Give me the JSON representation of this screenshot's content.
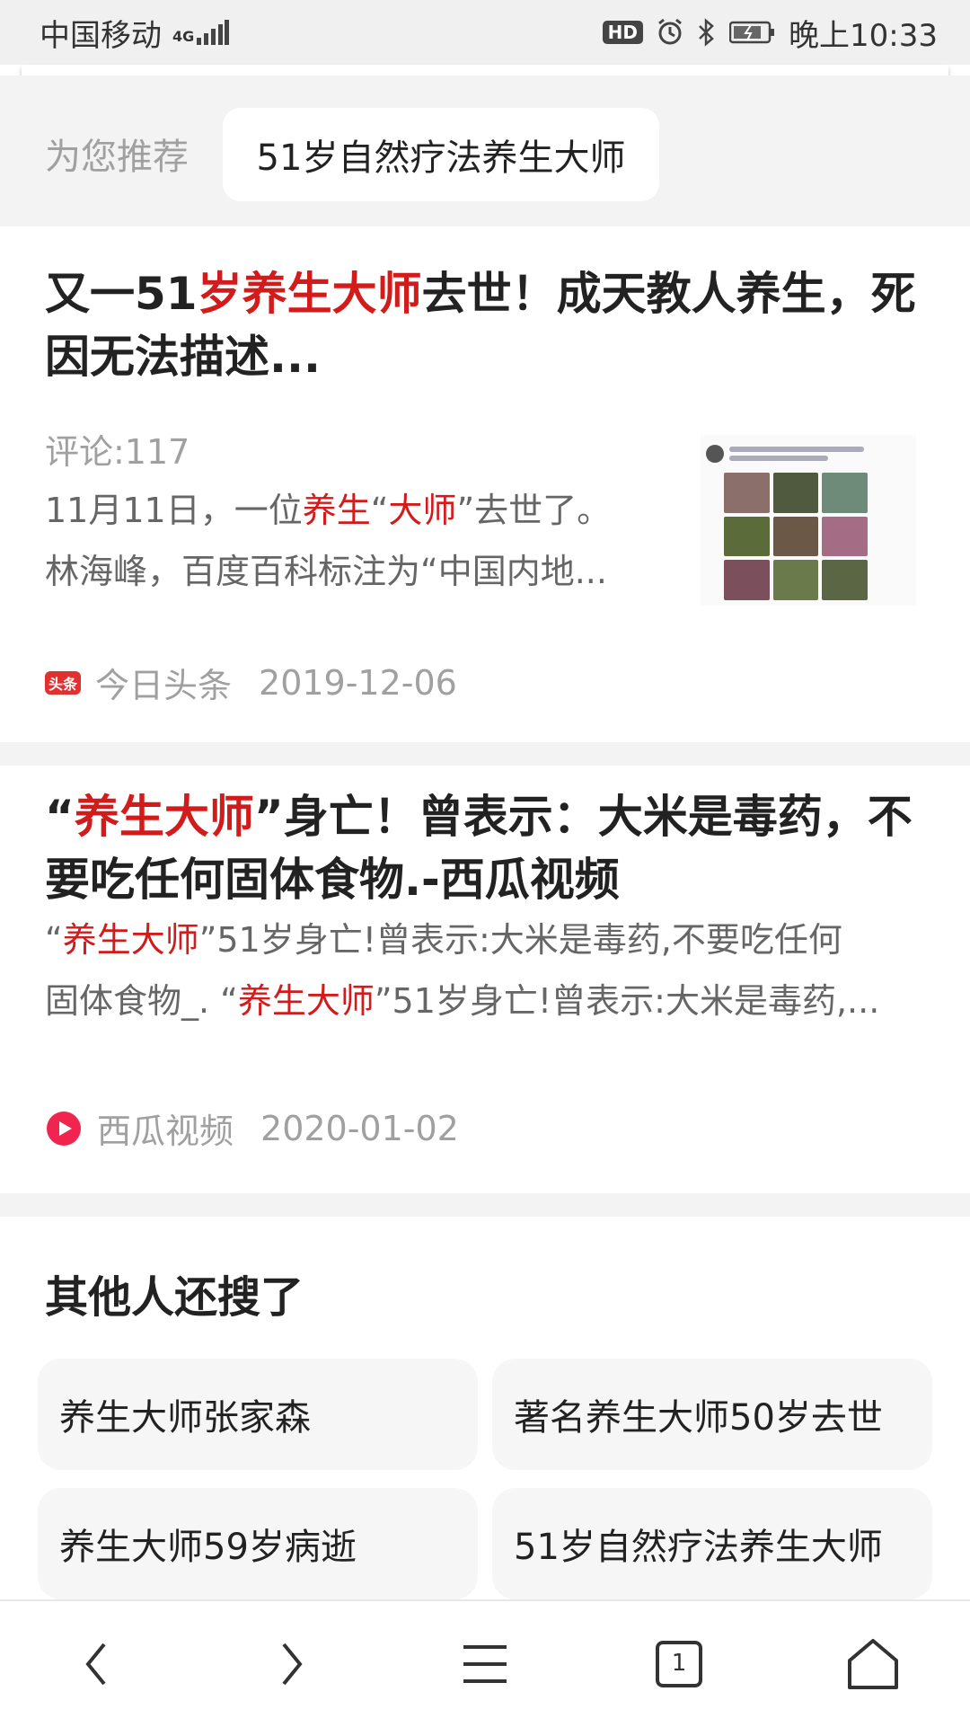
{
  "status_bar": {
    "carrier": "中国移动",
    "network": "4G",
    "hd_badge": "HD",
    "time": "晚上10:33"
  },
  "recommend": {
    "label": "为您推荐",
    "chip": "51岁自然疗法养生大师"
  },
  "results": [
    {
      "title_parts": [
        "又一51",
        "岁养生大师",
        "去世！成天教人养生，死因无法描述..."
      ],
      "comments": "评论:117",
      "snippet_line1_parts": [
        "11月11日，一位",
        "养生",
        "“",
        "大师",
        "”去世了。"
      ],
      "snippet_line2": "林海峰，百度百科标注为“中国内地...",
      "source": "今日头条",
      "source_icon_text": "头条",
      "date": "2019-12-06"
    },
    {
      "title_parts": [
        "“",
        "养生大师",
        "”身亡！曾表示：大米是毒药，不要吃任何固体食物.-西瓜视频"
      ],
      "snippet_line1_parts": [
        "“",
        "养生大师",
        "”51岁身亡!曾表示:大米是毒药,不要吃任何"
      ],
      "snippet_line2_parts": [
        "固体食物_. “",
        "养生大师",
        "”51岁身亡!曾表示:大米是毒药,..."
      ],
      "source": "西瓜视频",
      "date": "2020-01-02"
    }
  ],
  "related": {
    "title": "其他人还搜了",
    "items": [
      "养生大师张家森",
      "著名养生大师50岁去世",
      "养生大师59岁病逝",
      "51岁自然疗法养生大师"
    ]
  },
  "nav": {
    "tab_count": "1"
  },
  "icons": {
    "back": "chevron-left-icon",
    "forward": "chevron-right-icon",
    "menu": "menu-icon",
    "tabs": "tabs-icon",
    "home": "home-icon"
  },
  "colors": {
    "highlight": "#d21b1b",
    "toutiao_brand": "#e0302f",
    "xigua_brand": "#f0244e"
  }
}
